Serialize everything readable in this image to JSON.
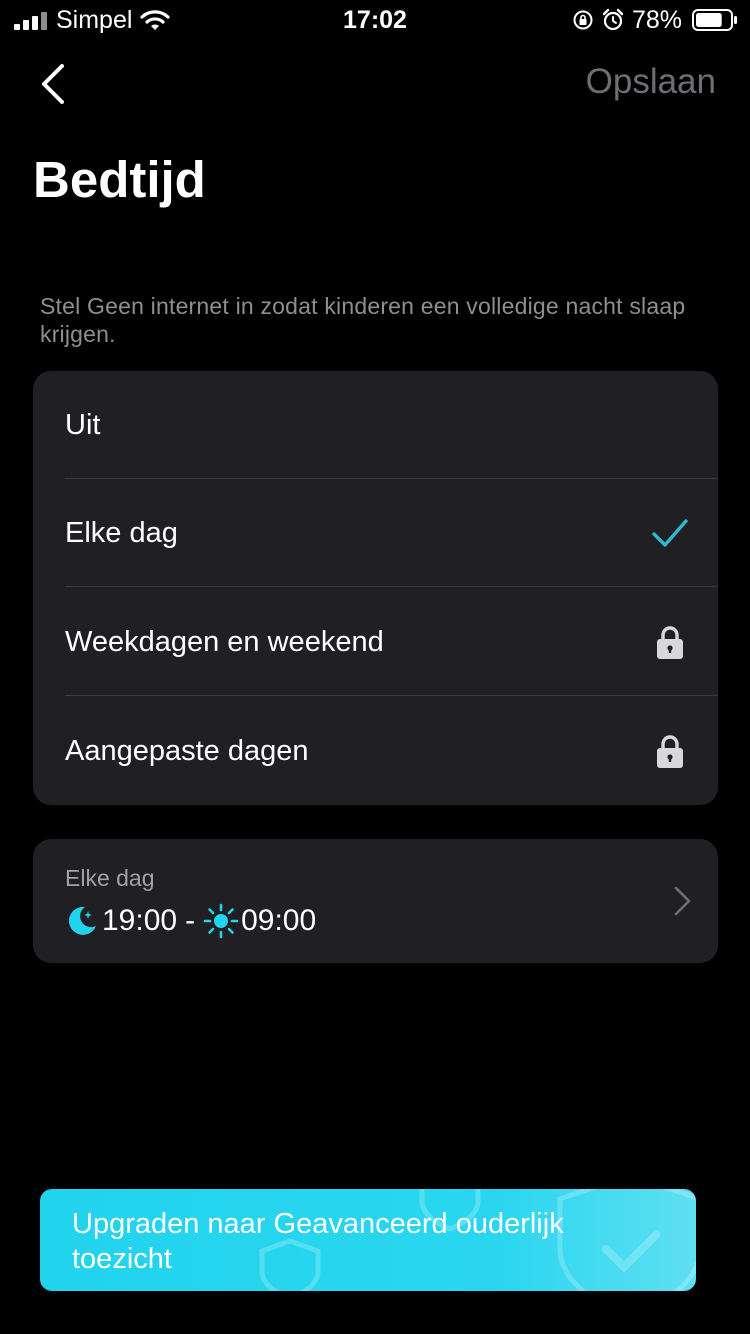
{
  "status_bar": {
    "carrier": "Simpel",
    "time": "17:02",
    "battery_percent": "78%",
    "battery_level": 0.78,
    "icons": [
      "signal-icon",
      "wifi-icon",
      "rotation-lock-icon",
      "alarm-icon",
      "battery-icon"
    ]
  },
  "nav": {
    "back_icon": "chevron-left-icon",
    "save_label": "Opslaan"
  },
  "page": {
    "title": "Bedtijd",
    "description": "Stel Geen internet in zodat kinderen een volledige nacht slaap krijgen."
  },
  "options": [
    {
      "label": "Uit",
      "state": "none"
    },
    {
      "label": "Elke dag",
      "state": "selected",
      "icon": "checkmark-icon"
    },
    {
      "label": "Weekdagen en weekend",
      "state": "locked",
      "icon": "lock-icon"
    },
    {
      "label": "Aangepaste dagen",
      "state": "locked",
      "icon": "lock-icon"
    }
  ],
  "schedule": {
    "label": "Elke dag",
    "start_time": "19:00",
    "separator": "-",
    "end_time": "09:00",
    "start_icon": "moon-icon",
    "end_icon": "sun-icon"
  },
  "upgrade": {
    "label": "Upgraden naar Geavanceerd ouderlijk toezicht"
  },
  "colors": {
    "background": "#000000",
    "card": "#1f1f24",
    "accent": "#22d3ee",
    "check": "#2fb8d4",
    "muted_text": "#8e8e93"
  }
}
